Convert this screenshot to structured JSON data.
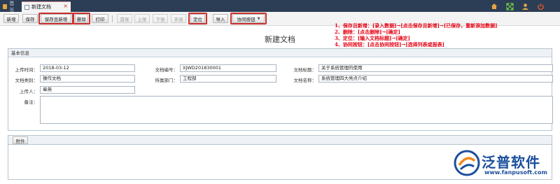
{
  "tabs": {
    "home_label": "首页",
    "active_label": "新建文档",
    "close_glyph": "×"
  },
  "top_icons": [
    "home-icon",
    "fullscreen-icon",
    "user-icon",
    "power-icon"
  ],
  "toolbar": {
    "new": "新增",
    "save": "保存",
    "save_and_new": "保存且新增",
    "delete": "删除",
    "print": "打印",
    "first": "首张",
    "prev": "上张",
    "next": "下张",
    "last": "末张",
    "locate": "定位",
    "import": "导入",
    "collaborate": "协同按钮"
  },
  "annotations": [
    "1、保存且新增：[录入数据]→[点击保存且新增]→[已保存，重新添加数据]",
    "2、删除：[点击删除]→[确定]",
    "3、定位：[输入文档标题]→[确定]",
    "4、协同按钮：[点击协同按钮]→[选择列表或报表]"
  ],
  "form": {
    "title": "新建文档",
    "section_title": "基本信息",
    "upload_time_label": "上传时间：",
    "upload_time_value": "2018-03-12",
    "doc_no_label": "文档编号：",
    "doc_no_value": "XJWD201830001",
    "doc_subject_label": "文档标题：",
    "doc_subject_value": "关于系统管理的使用",
    "doc_type_label": "文档类别：",
    "doc_type_value": "操作文档",
    "dept_label": "所属部门：",
    "dept_value": "工程部",
    "doc_name_label": "文档名称：",
    "doc_name_value": "系统管理四大亮点介绍",
    "uploader_label": "上传人：",
    "uploader_value": "章燕",
    "remark_label": "备注：",
    "remark_value": ""
  },
  "attachment": {
    "button": "附件"
  },
  "branding": {
    "name": "泛普软件",
    "url": "www.fanpusoft.com",
    "color": "#1a4f9c"
  },
  "colors": {
    "topbar": "#2c3e56",
    "highlight": "#c9302c",
    "annotation": "#e60012"
  }
}
